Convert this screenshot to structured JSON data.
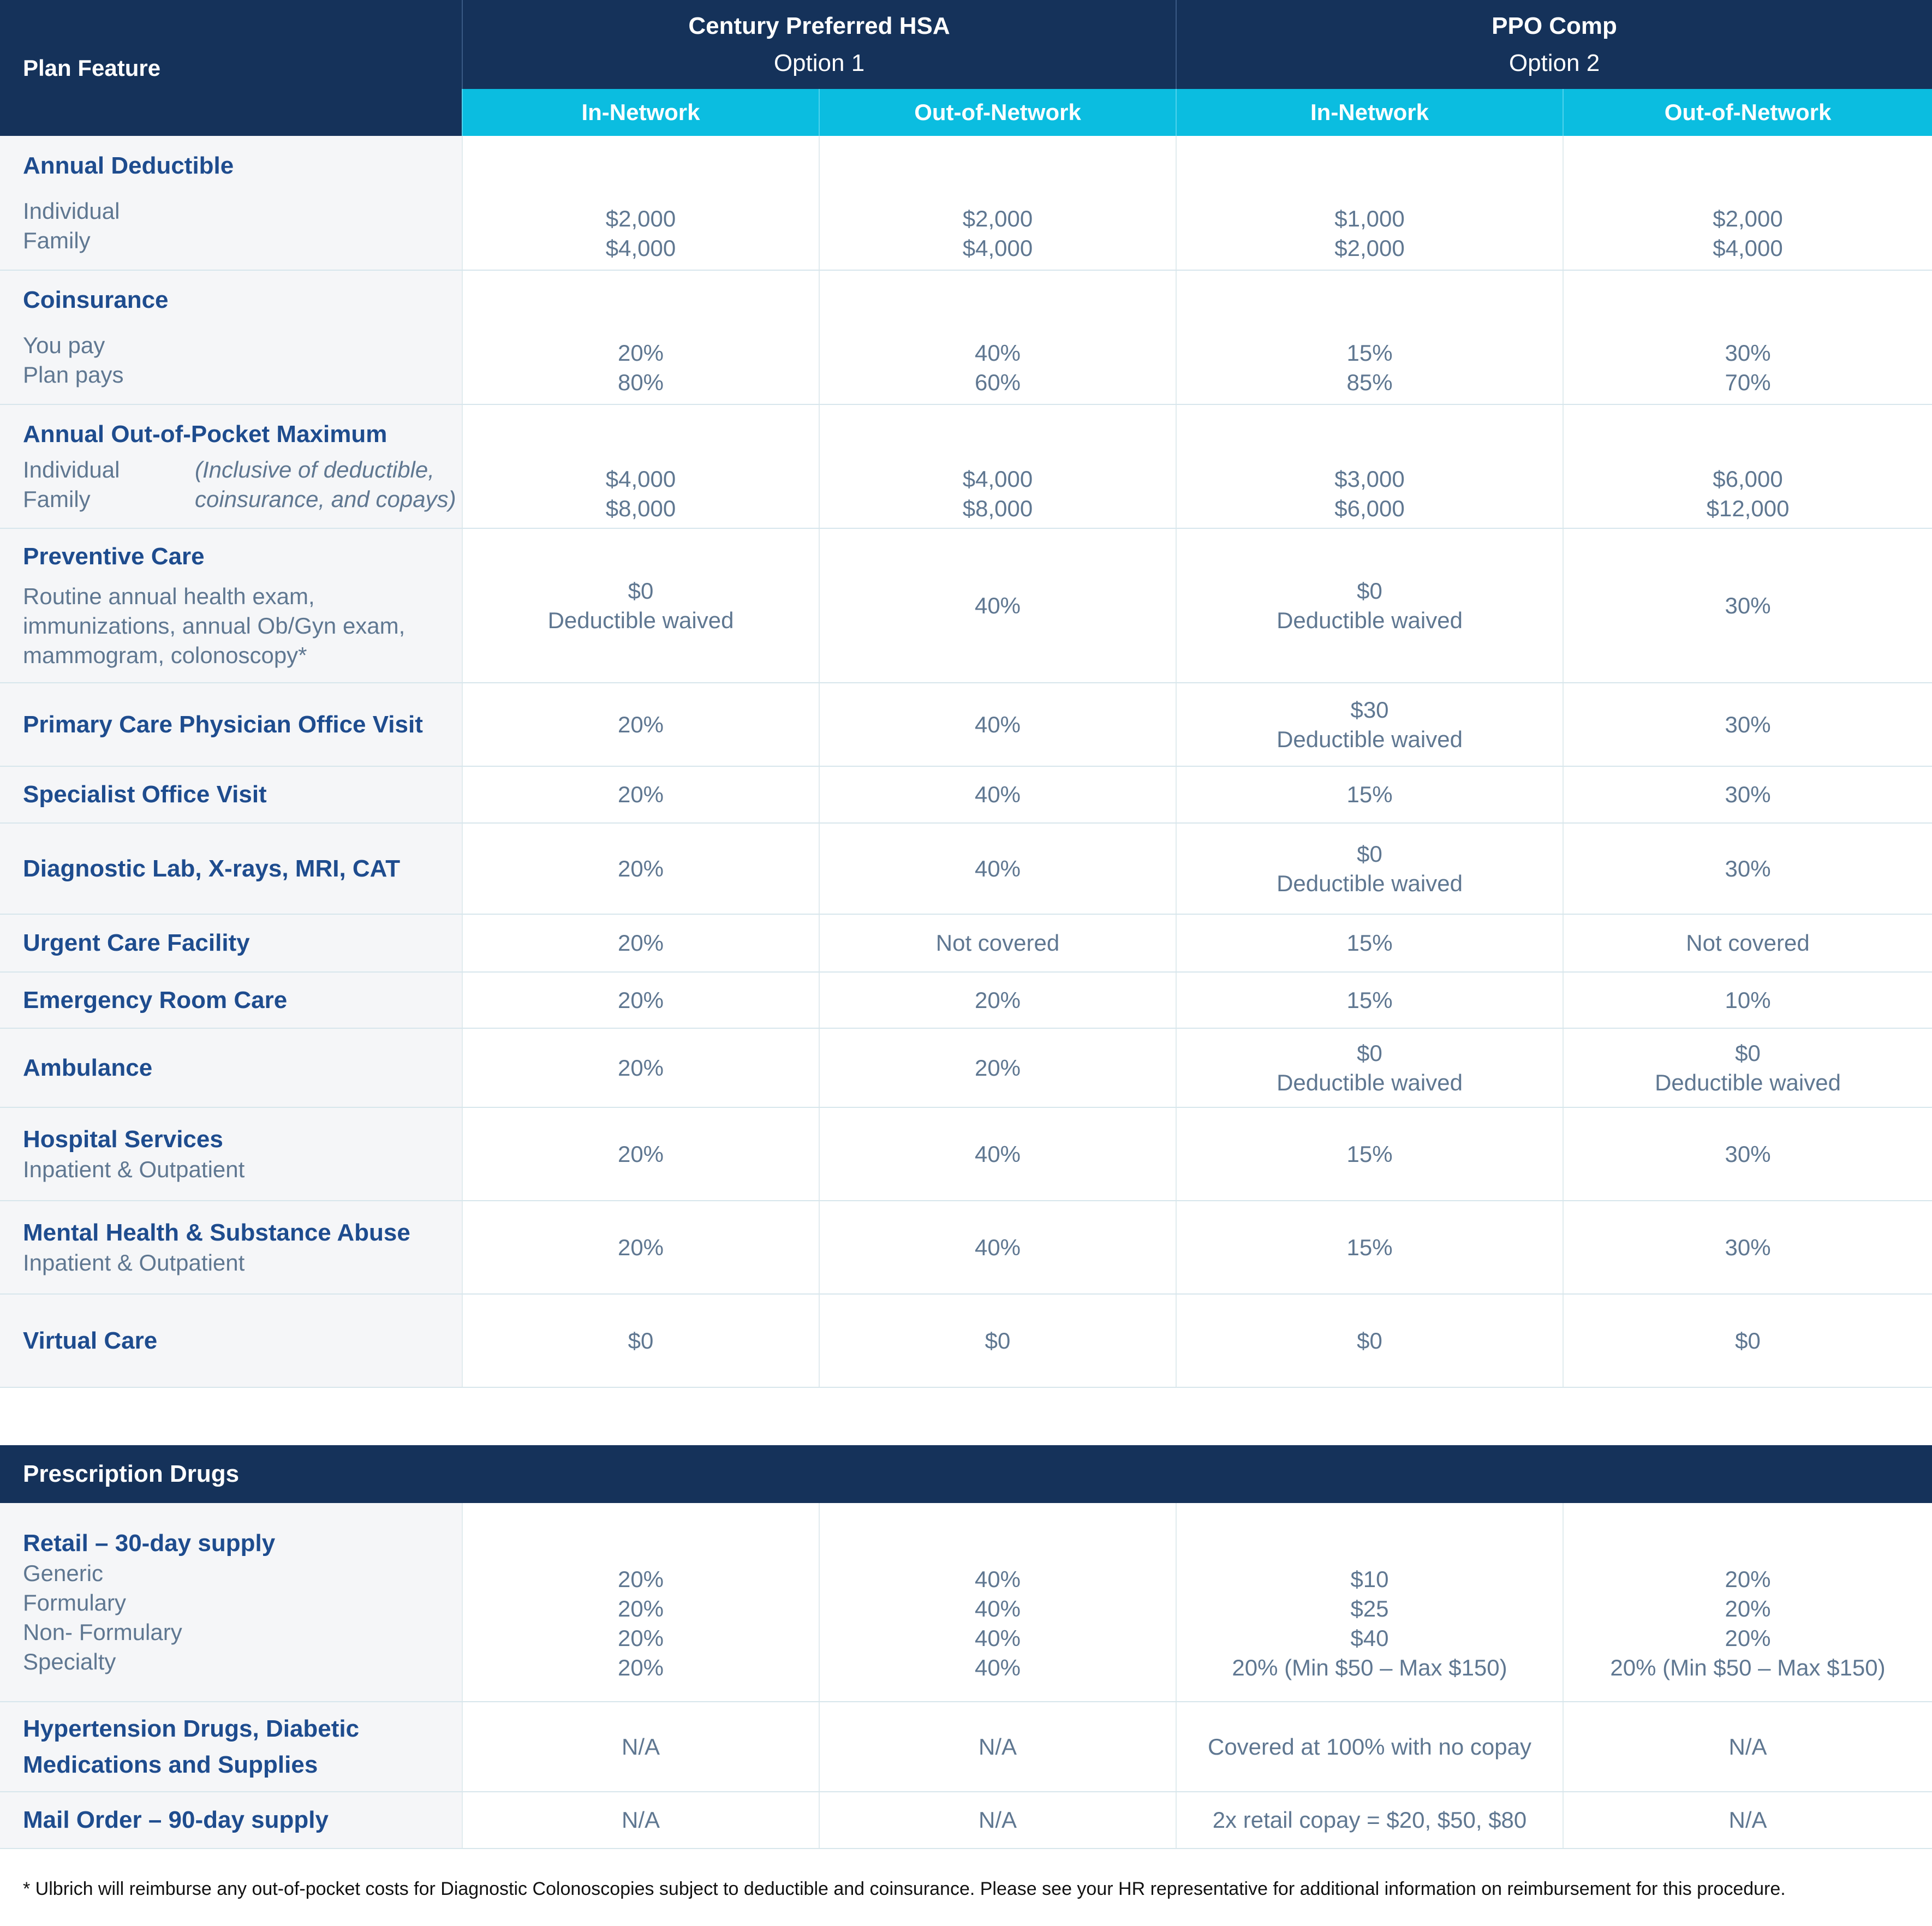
{
  "header": {
    "plan_feature": "Plan Feature",
    "plans": [
      {
        "name": "Century  Preferred  HSA",
        "option": "Option 1"
      },
      {
        "name": "PPO Comp",
        "option": "Option 2"
      }
    ],
    "network_cols": [
      "In-Network",
      "Out-of-Network",
      "In-Network",
      "Out-of-Network"
    ]
  },
  "rows": {
    "deductible": {
      "title": "Annual Deductible",
      "sub": [
        "Individual",
        "Family"
      ],
      "values": [
        [
          "$2,000",
          "$4,000"
        ],
        [
          "$2,000",
          "$4,000"
        ],
        [
          "$1,000",
          "$2,000"
        ],
        [
          "$2,000",
          "$4,000"
        ]
      ]
    },
    "coinsurance": {
      "title": "Coinsurance",
      "sub": [
        "You pay",
        "Plan pays"
      ],
      "values": [
        [
          "20%",
          "80%"
        ],
        [
          "40%",
          "60%"
        ],
        [
          "15%",
          "85%"
        ],
        [
          "30%",
          "70%"
        ]
      ]
    },
    "oop": {
      "title": "Annual  Out-of-Pocket  Maximum",
      "sub": [
        "Individual",
        "Family"
      ],
      "note": [
        "(Inclusive of deductible,",
        "coinsurance, and copays)"
      ],
      "values": [
        [
          "$4,000",
          "$8,000"
        ],
        [
          "$4,000",
          "$8,000"
        ],
        [
          "$3,000",
          "$6,000"
        ],
        [
          "$6,000",
          "$12,000"
        ]
      ]
    },
    "preventive": {
      "title": "Preventive  Care",
      "sub": [
        "Routine annual health exam,",
        "immunizations, annual Ob/Gyn exam,",
        "mammogram, colonoscopy*"
      ],
      "values": [
        [
          "$0",
          "Deductible waived"
        ],
        [
          "40%"
        ],
        [
          "$0",
          "Deductible waived"
        ],
        [
          "30%"
        ]
      ]
    },
    "pcp": {
      "title": "Primary Care Physician Office Visit",
      "values": [
        [
          "20%"
        ],
        [
          "40%"
        ],
        [
          "$30",
          "Deductible waived"
        ],
        [
          "30%"
        ]
      ]
    },
    "specialist": {
      "title": "Specialist  Office  Visit",
      "values": [
        [
          "20%"
        ],
        [
          "40%"
        ],
        [
          "15%"
        ],
        [
          "30%"
        ]
      ]
    },
    "diagnostic": {
      "title": "Diagnostic Lab, X-rays, MRI, CAT",
      "values": [
        [
          "20%"
        ],
        [
          "40%"
        ],
        [
          "$0",
          "Deductible waived"
        ],
        [
          "30%"
        ]
      ]
    },
    "urgent": {
      "title": "Urgent Care Facility",
      "values": [
        [
          "20%"
        ],
        [
          "Not covered"
        ],
        [
          "15%"
        ],
        [
          "Not covered"
        ]
      ]
    },
    "er": {
      "title": "Emergency Room Care",
      "values": [
        [
          "20%"
        ],
        [
          "20%"
        ],
        [
          "15%"
        ],
        [
          "10%"
        ]
      ]
    },
    "ambulance": {
      "title": "Ambulance",
      "values": [
        [
          "20%"
        ],
        [
          "20%"
        ],
        [
          "$0",
          "Deductible waived"
        ],
        [
          "$0",
          "Deductible waived"
        ]
      ]
    },
    "hospital": {
      "title": "Hospital Services",
      "sub": [
        "Inpatient & Outpatient"
      ],
      "values": [
        [
          "20%"
        ],
        [
          "40%"
        ],
        [
          "15%"
        ],
        [
          "30%"
        ]
      ]
    },
    "mental": {
      "title": "Mental Health & Substance Abuse",
      "sub": [
        "Inpatient & Outpatient"
      ],
      "values": [
        [
          "20%"
        ],
        [
          "40%"
        ],
        [
          "15%"
        ],
        [
          "30%"
        ]
      ]
    },
    "virtual": {
      "title": "Virtual Care",
      "values": [
        [
          "$0"
        ],
        [
          "$0"
        ],
        [
          "$0"
        ],
        [
          "$0"
        ]
      ]
    }
  },
  "rx": {
    "title": "Prescription Drugs",
    "retail": {
      "title": "Retail – 30-day supply",
      "sub": [
        "Generic",
        "Formulary",
        "Non- Formulary",
        "Specialty"
      ],
      "values": [
        [
          "20%",
          "20%",
          "20%",
          "20%"
        ],
        [
          "40%",
          "40%",
          "40%",
          "40%"
        ],
        [
          "$10",
          "$25",
          "$40",
          "20% (Min $50 – Max $150)"
        ],
        [
          "20%",
          "20%",
          "20%",
          "20% (Min $50 – Max $150)"
        ]
      ]
    },
    "hypertension": {
      "title": [
        "Hypertension Drugs, Diabetic",
        "Medications and Supplies"
      ],
      "values": [
        "N/A",
        "N/A",
        "Covered at 100% with no copay",
        "N/A"
      ]
    },
    "mail": {
      "title": "Mail Order – 90-day supply",
      "values": [
        "N/A",
        "N/A",
        "2x retail copay = $20, $50, $80",
        "N/A"
      ]
    }
  },
  "footnote": "* Ulbrich will reimburse any out-of-pocket costs for Diagnostic Colonoscopies subject to deductible and coinsurance. Please see your HR representative for additional information on  reimbursement for this procedure."
}
